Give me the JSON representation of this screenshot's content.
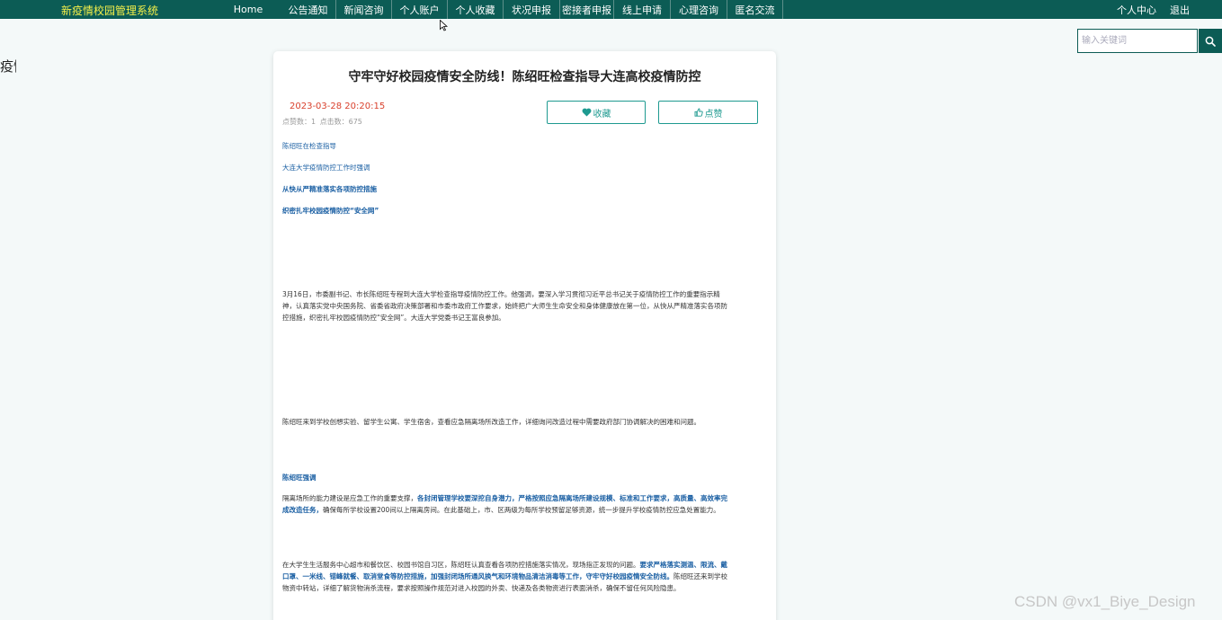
{
  "brand": "新疫情校园管理系统",
  "nav": {
    "items": [
      "Home",
      "公告通知",
      "新闻咨询",
      "个人账户",
      "个人收藏",
      "状况申报",
      "密接者申报",
      "线上申请",
      "心理咨询",
      "匿名交流"
    ],
    "right": [
      "个人中心",
      "退出"
    ]
  },
  "search": {
    "placeholder": "输入关键词",
    "icon": "search-icon"
  },
  "side_glyph": "疫情",
  "article": {
    "title": "守牢守好校园疫情安全防线！陈绍旺检查指导大连高校疫情防控",
    "date": "2023-03-28 20:20:15",
    "stats": "点赞数：1    点击数：675",
    "fav_label": "收藏",
    "like_label": "点赞",
    "paragraphs": [
      "陈绍旺在检查指导",
      "大连大学疫情防控工作时强调",
      "从快从严精准落实各项防控措施",
      "织密扎牢校园疫情防控“安全网”",
      "3月16日，市委副书记、市长陈绍旺专程到大连大学检查指导疫情防控工作。他强调，要深入学习贯彻习近平总书记关于疫情防控工作的重要指示精神，认真落实党中央国务院、省委省政府决策部署和市委市政府工作要求，始终把广大师生生命安全和身体健康放在第一位，从快从严精准落实各项防控措施，织密扎牢校园疫情防控“安全网”。大连大学党委书记王富良参加。",
      "陈绍旺来到学校创想实验、留学生公寓、学生宿舍，查看应急隔离场所改造工作，详细询问改造过程中需要政府部门协调解决的困难和问题。",
      "陈绍旺强调",
      "隔离场所的能力建设是应急工作的重要支撑，",
      "各封闭管理学校要深挖自身潜力，严格按照应急隔离场所建设规模、标准和工作要求，高质量、高效率完成改造任务，",
      "确保每所学校设置200间以上隔离房间。在此基础上，市、区两级为每所学校预留足够资源，统一步提升学校疫情防控应急处置能力。",
      "在大学生生活服务中心超市和餐饮区、校园书馆自习区，陈绍旺认真查看各项防控措施落实情况，现场指正发现的问题。",
      "要求严格落实测温、限流、戴口罩、一米线、错峰就餐、取消堂食等防控措施，加强封闭场所通风换气和环境物品清洁消毒等工作，守牢守好校园疫情安全防线。",
      "陈绍旺还来到学校物资中转站，详细了解货物消杀流程，要求按照操作规范对进入校园的外卖、快递及各类物资进行表面消杀，确保不留任何风险隐患。"
    ]
  },
  "watermark": "CSDN @vx1_Biye_Design",
  "colors": {
    "topbar": "#0c5c55",
    "brand": "#f2ee4a",
    "accent": "#1e9a90",
    "date": "#d9412d",
    "link": "#1a5fa3"
  }
}
